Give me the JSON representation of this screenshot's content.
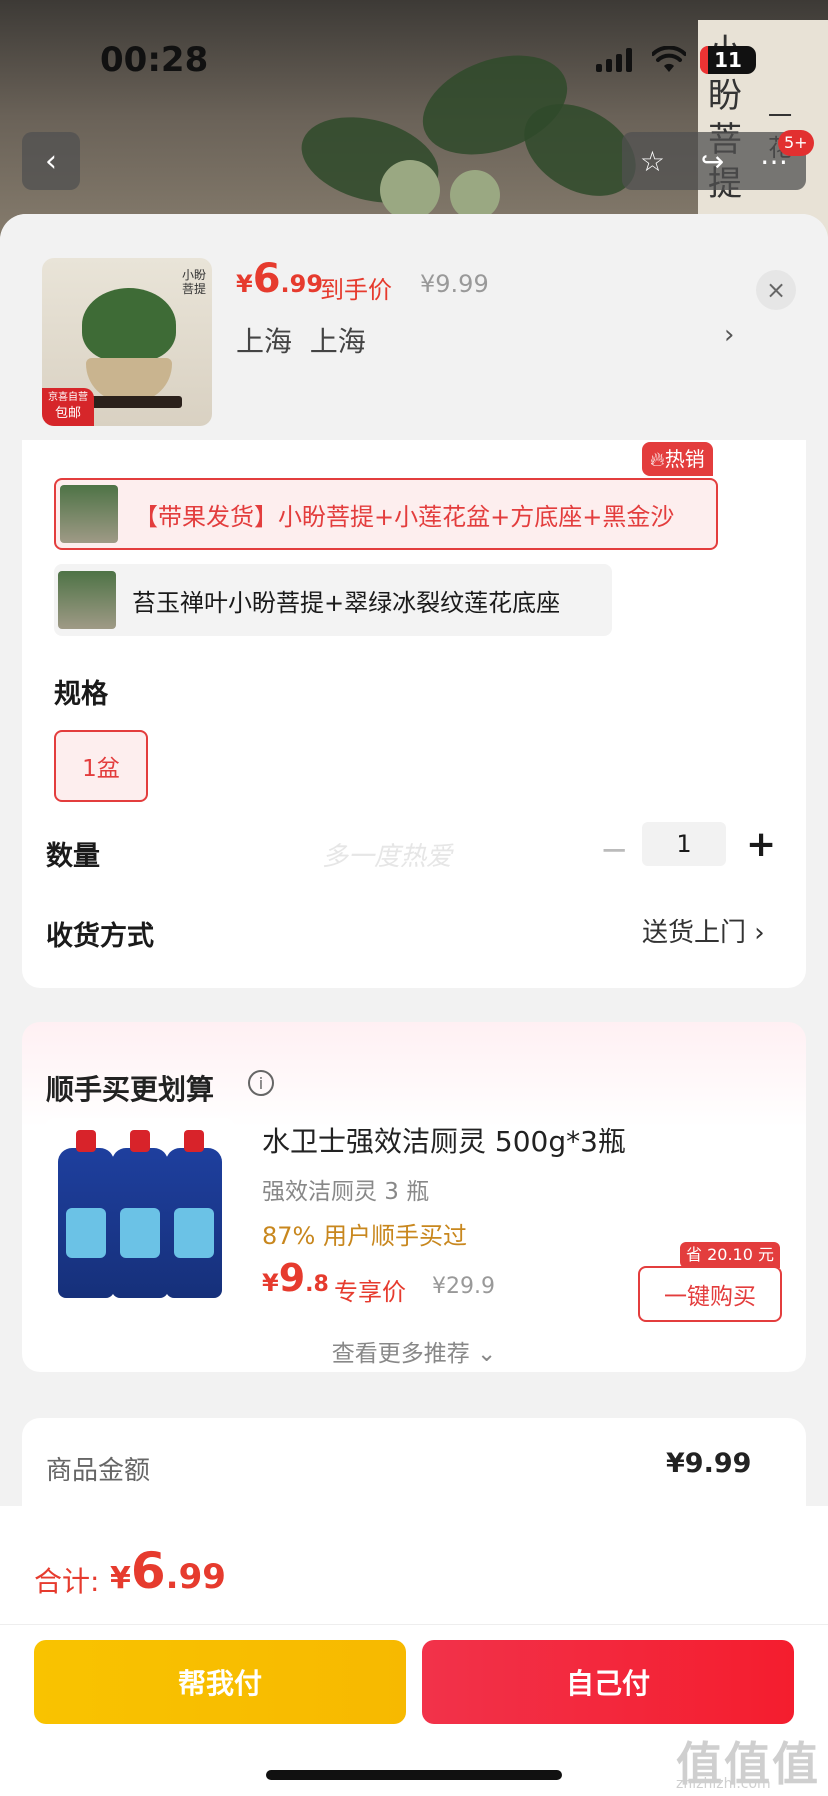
{
  "status_bar": {
    "time": "00:28",
    "battery": "11"
  },
  "top_nav": {
    "back_icon": "chevron-left-icon",
    "cart_badge": "5+"
  },
  "sheet": {
    "product": {
      "thumb_badge_top": "京喜自营",
      "thumb_badge_bottom": "包邮",
      "thumb_poster_text": "小盼菩提",
      "price_symbol": "¥",
      "price_int": "6",
      "price_dec": ".99",
      "price_label": "到手价",
      "original_price": "¥9.99",
      "address": "上海  上海",
      "address_chevron": "›",
      "close": "×"
    },
    "options": [
      {
        "label": "【带果发货】小盼菩提+小莲花盆+方底座+黑金沙",
        "selected": true,
        "hot_tag": "热销"
      },
      {
        "label": "苔玉禅叶小盼菩提+翠绿冰裂纹莲花底座",
        "selected": false
      }
    ],
    "spec": {
      "label": "规格",
      "value": "1盆"
    },
    "quantity": {
      "label": "数量",
      "watermark": "多一度热爱",
      "minus": "−",
      "value": "1",
      "plus": "+"
    },
    "shipping": {
      "label": "收货方式",
      "value": "送货上门 ›"
    }
  },
  "recommend": {
    "title": "顺手买更划算",
    "info_icon": "ⓘ",
    "item": {
      "title": "水卫士强效洁厕灵 500g*3瓶",
      "subtitle": "强效洁厕灵 3 瓶",
      "hint": "87% 用户顺手买过",
      "price_symbol": "¥",
      "price_int": "9",
      "price_dec": ".8",
      "price_label": "专享价",
      "original_price": "¥29.9",
      "save_tag": "省 20.10 元",
      "buy_label": "一键购买"
    },
    "more_label": "查看更多推荐 ⌄"
  },
  "summary": {
    "label": "商品金额",
    "value": "¥9.99"
  },
  "footer": {
    "total_label": "合计:",
    "total_symbol": "¥",
    "total_int": "6",
    "total_dec": ".99",
    "pay_help": "帮我付",
    "pay_self": "自己付",
    "watermark": "值值值",
    "watermark_sub": "zhizhizhi.com"
  },
  "colors": {
    "accent": "#e63b2e",
    "pay_help": "#f9c300",
    "pay_self": "#f2324a",
    "hint": "#c8871e"
  }
}
